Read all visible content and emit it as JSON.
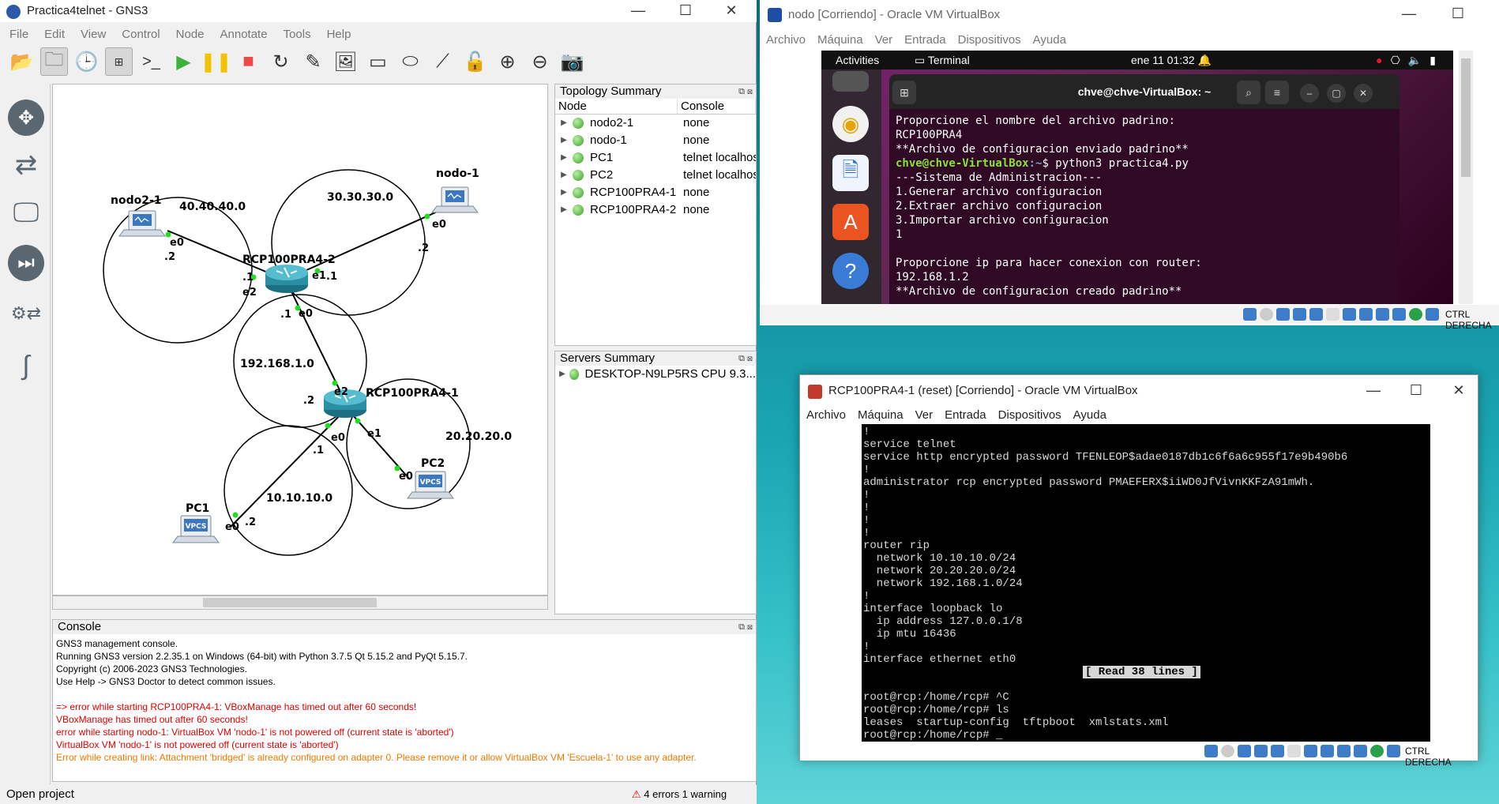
{
  "gns3": {
    "title": "Practica4telnet - GNS3",
    "menu": [
      "File",
      "Edit",
      "View",
      "Control",
      "Node",
      "Annotate",
      "Tools",
      "Help"
    ],
    "topology": {
      "title": "Topology Summary",
      "columns": [
        "Node",
        "Console"
      ],
      "rows": [
        {
          "node": "nodo2-1",
          "console": "none"
        },
        {
          "node": "nodo-1",
          "console": "none"
        },
        {
          "node": "PC1",
          "console": "telnet localhost"
        },
        {
          "node": "PC2",
          "console": "telnet localhost"
        },
        {
          "node": "RCP100PRA4-1",
          "console": "none"
        },
        {
          "node": "RCP100PRA4-2",
          "console": "none"
        }
      ]
    },
    "servers": {
      "title": "Servers Summary",
      "rows": [
        "DESKTOP-N9LP5RS CPU 9.3..."
      ]
    },
    "diagram": {
      "nodes": {
        "nodo21": "nodo2-1",
        "nodo1": "nodo-1",
        "rcp2": "RCP100PRA4-2",
        "rcp1": "RCP100PRA4-1",
        "pc1": "PC1",
        "pc2": "PC2"
      },
      "networks": {
        "n40": "40.40.40.0",
        "n30": "30.30.30.0",
        "n192": "192.168.1.0",
        "n20": "20.20.20.0",
        "n10": "10.10.10.0"
      },
      "vpcs": "VPCS",
      "labels": {
        "nodo21_e0": "e0",
        "nodo21_ip": ".2",
        "nodo1_e0": "e0",
        "nodo1_ip": ".2",
        "rcp2_e2": "e2",
        "rcp2_ip_left": ".1",
        "rcp2_e1": "e1",
        "rcp2_ip_right": ".1",
        "rcp2_ip_bottom": ".1",
        "rcp2_e0": "e0",
        "rcp1_e2": "e2",
        "rcp1_ip_top": ".2",
        "rcp1_e0": "e0",
        "rcp1_e1": "e1",
        "rcp1_ip_bottom": ".1",
        "pc1_e0": "e0",
        "pc1_ip": ".2",
        "pc2_e0": "e0"
      }
    },
    "console": {
      "title": "Console",
      "lines": [
        {
          "text": "GNS3 management console.",
          "color": "black"
        },
        {
          "text": "Running GNS3 version 2.2.35.1 on Windows (64-bit) with Python 3.7.5 Qt 5.15.2 and PyQt 5.15.7.",
          "color": "black"
        },
        {
          "text": "Copyright (c) 2006-2023 GNS3 Technologies.",
          "color": "black"
        },
        {
          "text": "Use Help -> GNS3 Doctor to detect common issues.",
          "color": "black"
        },
        {
          "text": "",
          "color": "black"
        },
        {
          "text": "=> error while starting RCP100PRA4-1: VBoxManage has timed out after 60 seconds!",
          "color": "red"
        },
        {
          "text": "VBoxManage has timed out after 60 seconds!",
          "color": "red"
        },
        {
          "text": "error while starting nodo-1: VirtualBox VM 'nodo-1' is not powered off (current state is 'aborted')",
          "color": "red"
        },
        {
          "text": "VirtualBox VM 'nodo-1' is not powered off (current state is 'aborted')",
          "color": "red"
        },
        {
          "text": "Error while creating link: Attachment 'bridged' is already configured on adapter 0. Please remove it or allow VirtualBox VM 'Escuela-1' to use any adapter.",
          "color": "orange"
        }
      ]
    },
    "status": "Open project",
    "errors": "4 errors 1 warning"
  },
  "vbox_nodo": {
    "title": "nodo [Corriendo] - Oracle VM VirtualBox",
    "menu": [
      "Archivo",
      "Máquina",
      "Ver",
      "Entrada",
      "Dispositivos",
      "Ayuda"
    ],
    "ubuntu": {
      "activities": "Activities",
      "app": "Terminal",
      "clock": "ene 11  01:32"
    },
    "terminal": {
      "title": "chve@chve-VirtualBox: ~",
      "lines": [
        {
          "t": "Proporcione el nombre del archivo padrino:"
        },
        {
          "t": "RCP100PRA4"
        },
        {
          "t": "**Archivo de configuracion enviado padrino**"
        },
        {
          "prompt_user": "chve@chve-VirtualBox",
          "prompt_path": ":~",
          "cmd": "$ python3 practica4.py"
        },
        {
          "t": "---Sistema de Administracion---"
        },
        {
          "t": "1.Generar archivo configuracion"
        },
        {
          "t": "2.Extraer archivo configuracion"
        },
        {
          "t": "3.Importar archivo configuracion"
        },
        {
          "t": "1"
        },
        {
          "t": ""
        },
        {
          "t": "Proporcione ip para hacer conexion con router:"
        },
        {
          "t": "192.168.1.2"
        },
        {
          "t": "**Archivo de configuracion creado padrino**"
        }
      ]
    },
    "hostkey": "CTRL DERECHA"
  },
  "vbox_rcp": {
    "title": "RCP100PRA4-1 (reset) [Corriendo] - Oracle VM VirtualBox",
    "menu": [
      "Archivo",
      "Máquina",
      "Ver",
      "Entrada",
      "Dispositivos",
      "Ayuda"
    ],
    "screen_lines": [
      "!",
      "service telnet",
      "service http encrypted password TFENLEOP$adae0187db1c6f6a6c955f17e9b490b6",
      "!",
      "administrator rcp encrypted password PMAEFERX$iiWD0JfVivnKKFzA91mWh.",
      "!",
      "!",
      "!",
      "!",
      "router rip",
      "  network 10.10.10.0/24",
      "  network 20.20.20.0/24",
      "  network 192.168.1.0/24",
      "!",
      "interface loopback lo",
      "  ip address 127.0.0.1/8",
      "  ip mtu 16436",
      "!",
      "interface ethernet eth0",
      "",
      "",
      "root@rcp:/home/rcp# ^C",
      "root@rcp:/home/rcp# ls",
      "leases  startup-config  tftpboot  xmlstats.xml",
      "root@rcp:/home/rcp# _"
    ],
    "read_info": "[ Read 38 lines ]",
    "hostkey": "CTRL DERECHA"
  }
}
